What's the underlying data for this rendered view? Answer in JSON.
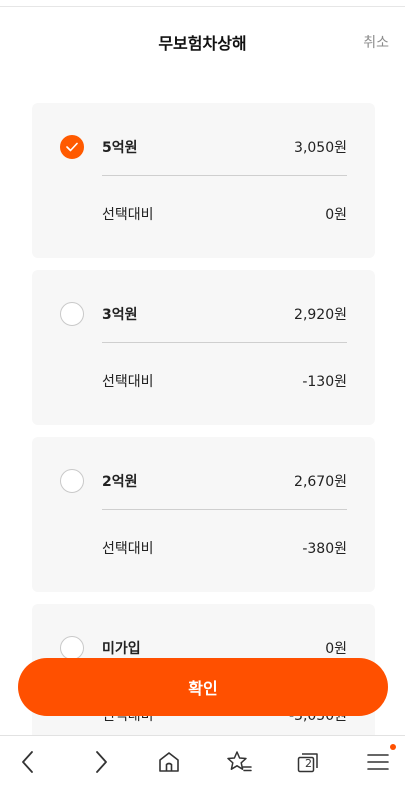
{
  "header": {
    "title": "무보험차상해",
    "cancel_label": "취소"
  },
  "options": [
    {
      "name": "5억원",
      "price": "3,050원",
      "diff_label": "선택대비",
      "diff_value": "0원",
      "selected": true
    },
    {
      "name": "3억원",
      "price": "2,920원",
      "diff_label": "선택대비",
      "diff_value": "-130원",
      "selected": false
    },
    {
      "name": "2억원",
      "price": "2,670원",
      "diff_label": "선택대비",
      "diff_value": "-380원",
      "selected": false
    },
    {
      "name": "미가입",
      "price": "0원",
      "diff_label": "선택대비",
      "diff_value": "-3,050원",
      "selected": false
    }
  ],
  "confirm_label": "확인",
  "browser_bar": {
    "tab_count": "2",
    "icons": [
      "back-icon",
      "forward-icon",
      "home-icon",
      "favorites-icon",
      "tabs-icon",
      "menu-icon"
    ],
    "accent_color": "#ff5000"
  }
}
